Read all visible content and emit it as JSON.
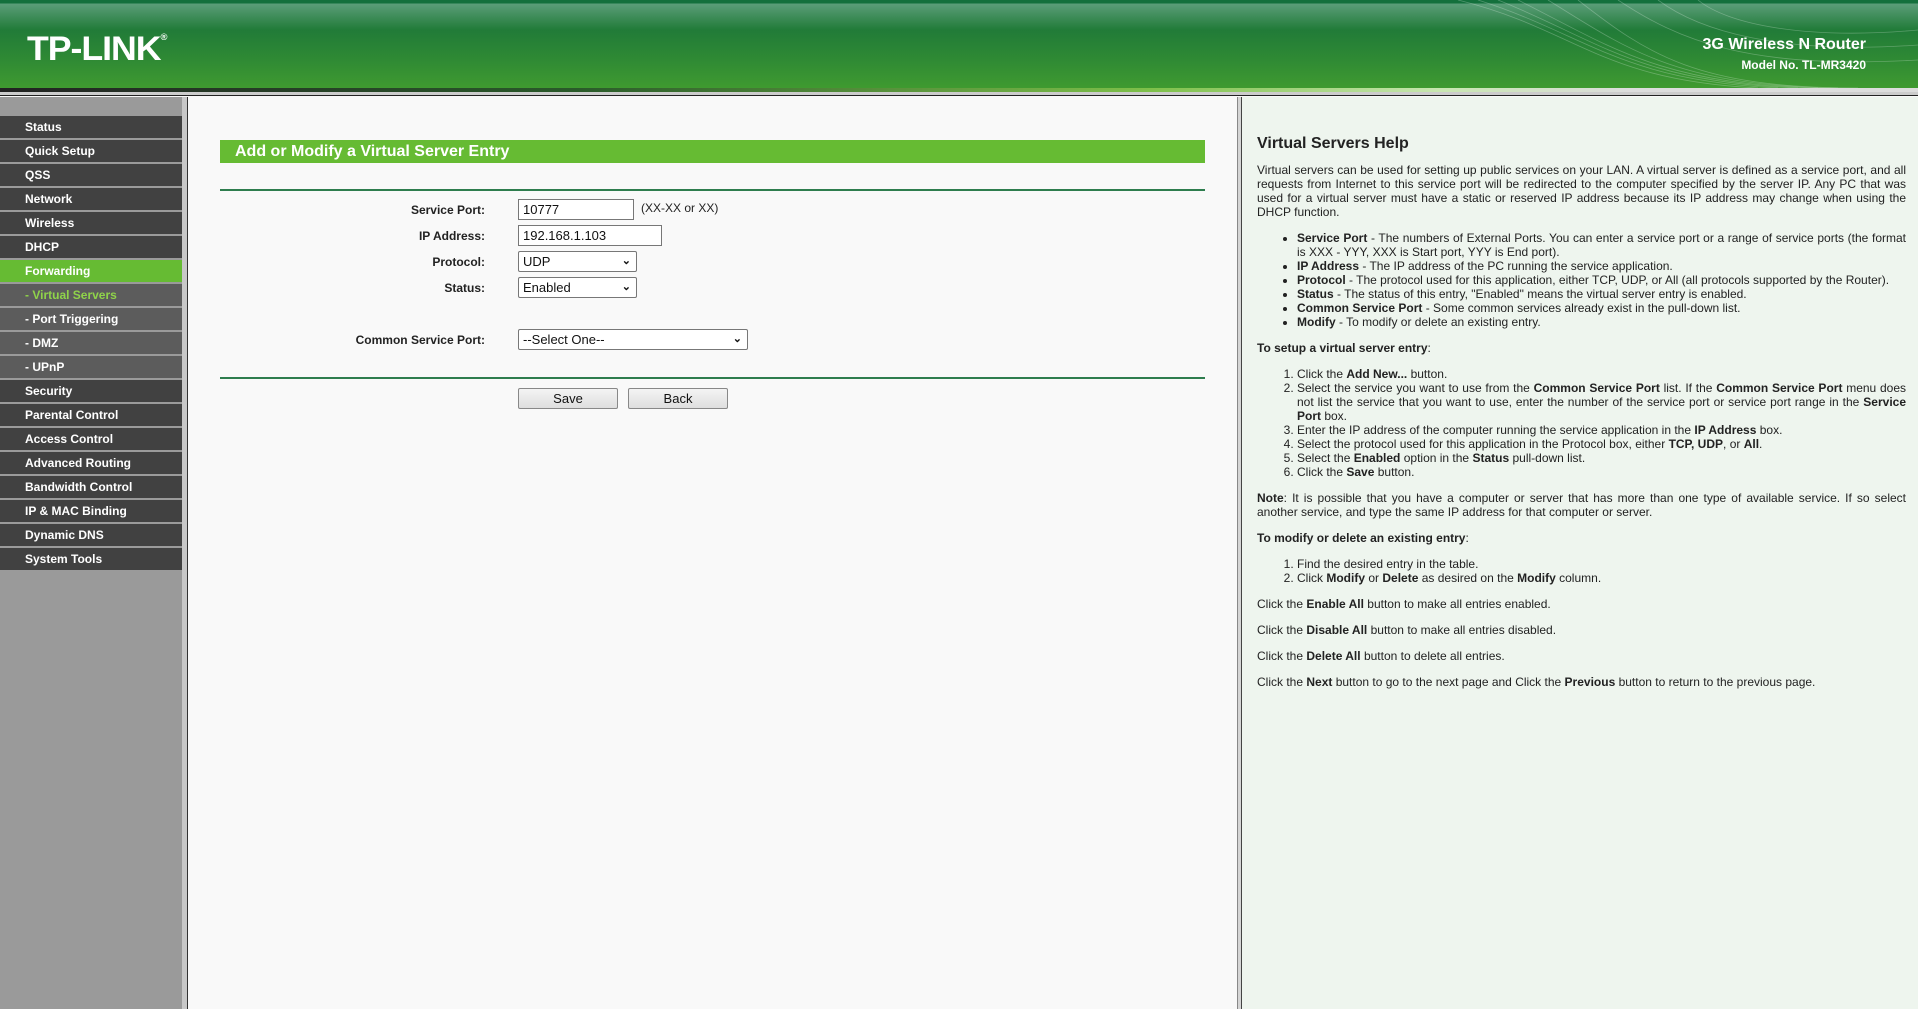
{
  "header": {
    "logo": "TP-LINK",
    "logo_mark": "®",
    "product": "3G Wireless N Router",
    "model": "Model No. TL-MR3420",
    "colors": {
      "brand_green": "#2f8a34",
      "accent": "#66bb33"
    }
  },
  "sidebar": {
    "items": [
      {
        "label": "Status",
        "type": "main"
      },
      {
        "label": "Quick Setup",
        "type": "main"
      },
      {
        "label": "QSS",
        "type": "main"
      },
      {
        "label": "Network",
        "type": "main"
      },
      {
        "label": "Wireless",
        "type": "main"
      },
      {
        "label": "DHCP",
        "type": "main"
      },
      {
        "label": "Forwarding",
        "type": "active"
      },
      {
        "label": "- Virtual Servers",
        "type": "current"
      },
      {
        "label": "- Port Triggering",
        "type": "sub"
      },
      {
        "label": "- DMZ",
        "type": "sub"
      },
      {
        "label": "- UPnP",
        "type": "sub"
      },
      {
        "label": "Security",
        "type": "main"
      },
      {
        "label": "Parental Control",
        "type": "main"
      },
      {
        "label": "Access Control",
        "type": "main"
      },
      {
        "label": "Advanced Routing",
        "type": "main"
      },
      {
        "label": "Bandwidth Control",
        "type": "main"
      },
      {
        "label": "IP & MAC Binding",
        "type": "main"
      },
      {
        "label": "Dynamic DNS",
        "type": "main"
      },
      {
        "label": "System Tools",
        "type": "main"
      }
    ]
  },
  "form": {
    "title": "Add or Modify a Virtual Server Entry",
    "service_port": {
      "label": "Service Port:",
      "value": "10777",
      "hint": "(XX-XX or XX)"
    },
    "ip_address": {
      "label": "IP Address:",
      "value": "192.168.1.103"
    },
    "protocol": {
      "label": "Protocol:",
      "value": "UDP"
    },
    "status": {
      "label": "Status:",
      "value": "Enabled"
    },
    "common_service_port": {
      "label": "Common Service Port:",
      "value": "--Select One--"
    },
    "save_label": "Save",
    "back_label": "Back"
  },
  "help": {
    "title": "Virtual Servers Help",
    "intro": "Virtual servers can be used for setting up public services on your LAN. A virtual server is defined as a service port, and all requests from Internet to this service port will be redirected to the computer specified by the server IP. Any PC that was used for a virtual server must have a static or reserved IP address because its IP address may change when using the DHCP function.",
    "bullets": [
      {
        "term": "Service Port",
        "text": " - The numbers of External Ports. You can enter a service port or a range of service ports (the format is XXX - YYY, XXX is Start port, YYY is End port)."
      },
      {
        "term": "IP Address",
        "text": " - The IP address of the PC running the service application."
      },
      {
        "term": "Protocol",
        "text": " - The protocol used for this application, either TCP, UDP, or All (all protocols supported by the Router)."
      },
      {
        "term": "Status",
        "text": " - The status of this entry, \"Enabled\" means the virtual server entry is enabled."
      },
      {
        "term": "Common Service Port",
        "text": " - Some common services already exist in the pull-down list."
      },
      {
        "term": "Modify",
        "text": " - To modify or delete an existing entry."
      }
    ],
    "setup_heading": "To setup a virtual server entry",
    "setup_steps": [
      "Click the Add New... button.",
      "Select the service you want to use from the Common Service Port list. If the Common Service Port menu does not list the service that you want to use, enter the number of the service port or service port range in the Service Port box.",
      "Enter the IP address of the computer running the service application in the IP Address box.",
      "Select the protocol used for this application in the Protocol box, either TCP, UDP, or All.",
      "Select the Enabled option in the Status pull-down list.",
      "Click the Save button."
    ],
    "note_term": "Note",
    "note": ": It is possible that you have a computer or server that has more than one type of available service. If so select another service, and type the same IP address for that computer or server.",
    "modify_heading": "To modify or delete an existing entry",
    "modify_steps": [
      "Find the desired entry in the table.",
      "Click Modify or Delete as desired on the Modify column."
    ],
    "enable_all": "Click the Enable All button to make all entries enabled.",
    "disable_all": "Click the Disable All button to make all entries disabled.",
    "delete_all": "Click the Delete All button to delete all entries.",
    "paging": "Click the Next button to go to the next page and Click the Previous button to return to the previous page."
  }
}
